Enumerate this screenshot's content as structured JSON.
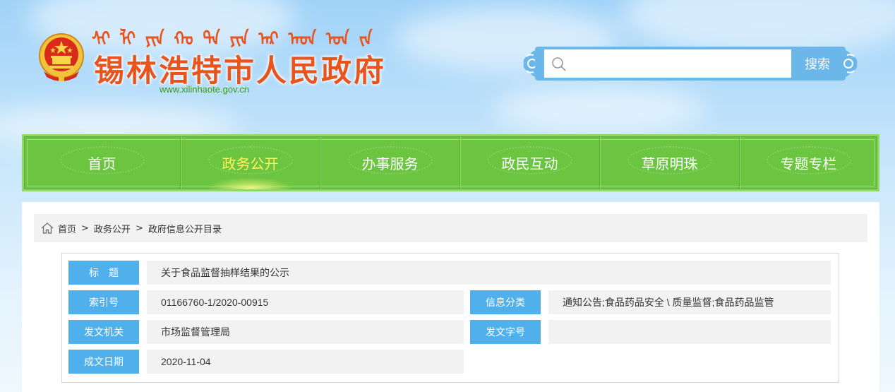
{
  "header": {
    "mongolian_script": [
      "ᠰᠢ",
      "ᠯᠢ",
      "ᠶᠢᠨ",
      "ᠬᠣ",
      "ᠲᠠ",
      "ᠶᠢᠨ",
      "ᠠᠷ",
      "ᠠᠳ",
      "ᠤᠨ",
      "ᠵᠠ"
    ],
    "site_title": "锡林浩特市人民政府",
    "site_url": "www.xilinhaote.gov.cn",
    "search_placeholder": "",
    "search_button": "搜索"
  },
  "nav": {
    "items": [
      {
        "label": "首页",
        "active": false
      },
      {
        "label": "政务公开",
        "active": true
      },
      {
        "label": "办事服务",
        "active": false
      },
      {
        "label": "政民互动",
        "active": false
      },
      {
        "label": "草原明珠",
        "active": false
      },
      {
        "label": "专题专栏",
        "active": false
      }
    ]
  },
  "breadcrumb": {
    "items": [
      "首页",
      "政务公开",
      "政府信息公开目录"
    ],
    "separator": ">"
  },
  "info": {
    "title_label": "标　题",
    "title_value": "关于食品监督抽样结果的公示",
    "index_label": "索引号",
    "index_value": "01166760-1/2020-00915",
    "category_label": "信息分类",
    "category_value": "通知公告;食品药品安全 \\ 质量监督;食品药品监管",
    "issuer_label": "发文机关",
    "issuer_value": "市场监督管理局",
    "doc_number_label": "发文字号",
    "doc_number_value": "",
    "date_label": "成文日期",
    "date_value": "2020-11-04"
  },
  "colors": {
    "nav_green": "#6cc540",
    "active_yellow": "#fff35a",
    "label_blue": "#4fb0ec",
    "title_orange": "#e8541d"
  }
}
